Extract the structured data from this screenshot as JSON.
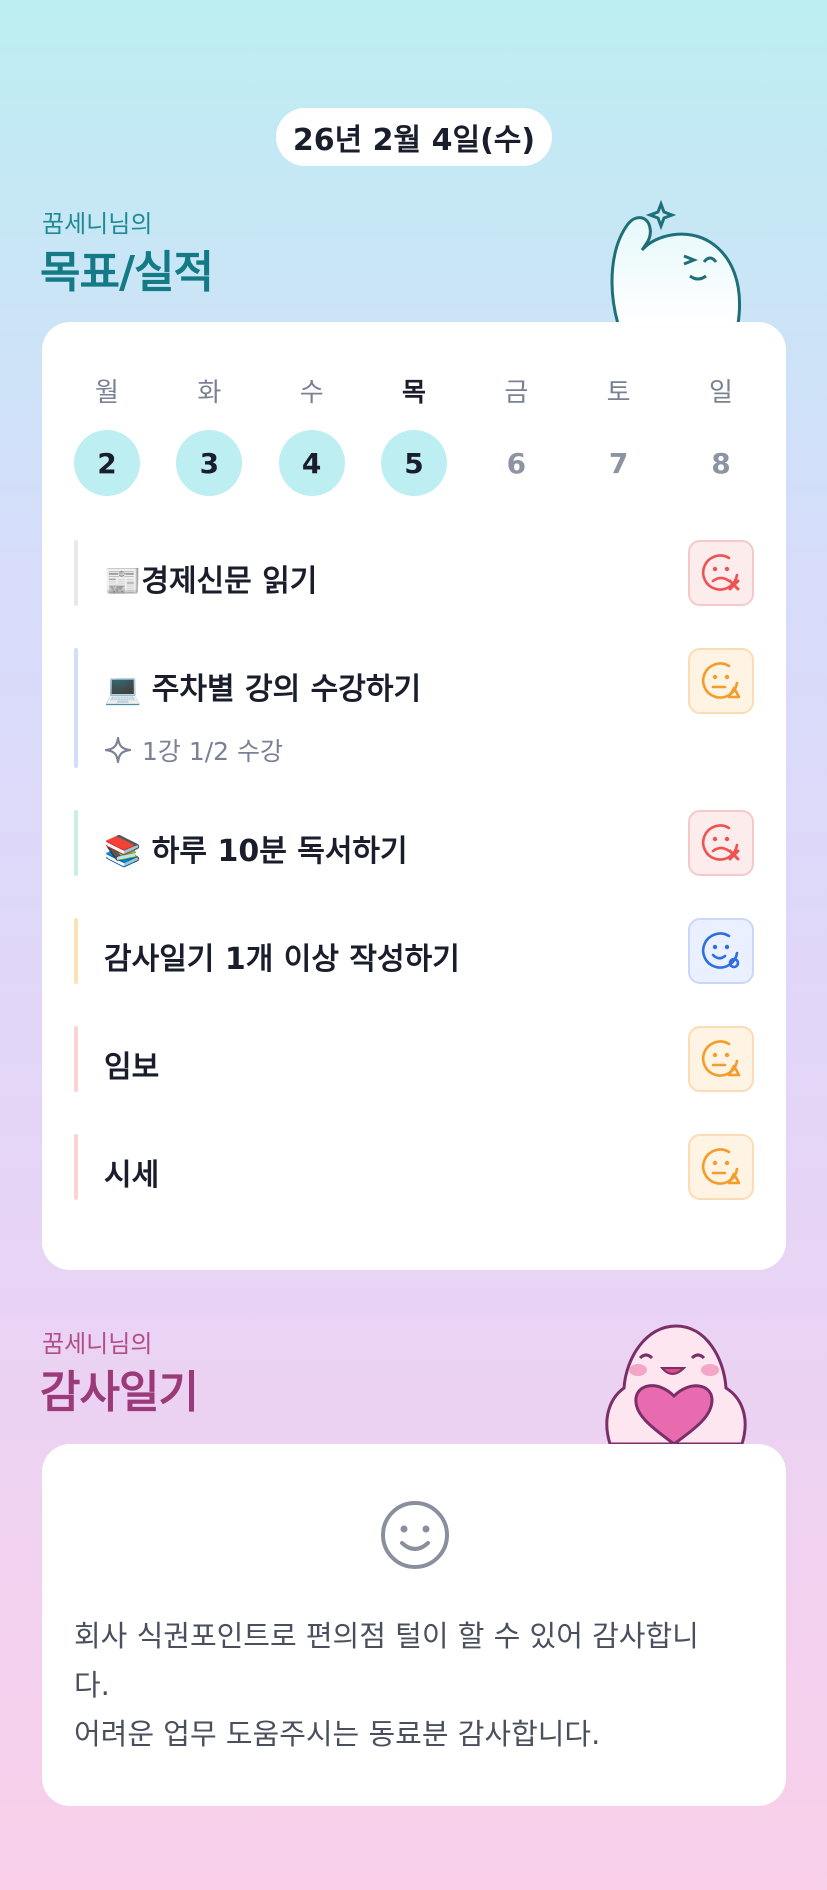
{
  "header": {
    "date": "26년 2월 4일(수)"
  },
  "goals_section": {
    "subtitle": "꿈세니님의",
    "title": "목표/실적"
  },
  "week": {
    "days": [
      "월",
      "화",
      "수",
      "목",
      "금",
      "토",
      "일"
    ],
    "dates": [
      "2",
      "3",
      "4",
      "5",
      "6",
      "7",
      "8"
    ],
    "done_flags": [
      true,
      true,
      true,
      true,
      false,
      false,
      false
    ],
    "today_index": 3
  },
  "goals": [
    {
      "label": "📰경제신문 읽기",
      "status": "fail",
      "bar_color": "#e8e8ea"
    },
    {
      "label": "💻 주차별 강의 수강하기",
      "note": "1강 1/2 수강",
      "status": "partial",
      "bar_color": "#d3dcfb"
    },
    {
      "label": "📚 하루 10분 독서하기",
      "status": "fail",
      "bar_color": "#c8efe0"
    },
    {
      "label": "감사일기 1개 이상 작성하기",
      "status": "success",
      "bar_color": "#fde2b8"
    },
    {
      "label": "임보",
      "status": "partial",
      "bar_color": "#fbd3d3"
    },
    {
      "label": "시세",
      "status": "partial",
      "bar_color": "#fbd3d3"
    }
  ],
  "thanks_section": {
    "subtitle": "꿈세니님의",
    "title": "감사일기",
    "face_icon": "smile-face-icon",
    "lines": [
      "회사 식권포인트로 편의점 털이 할 수 있어 감사합니",
      "다.",
      "어려운 업무 도움주시는 동료분 감사합니다."
    ]
  },
  "colors": {
    "fail": "#ee5253",
    "partial": "#f39c2a",
    "success": "#2f6ee0",
    "accent_teal": "#137a86",
    "accent_pink": "#9b3a78"
  }
}
